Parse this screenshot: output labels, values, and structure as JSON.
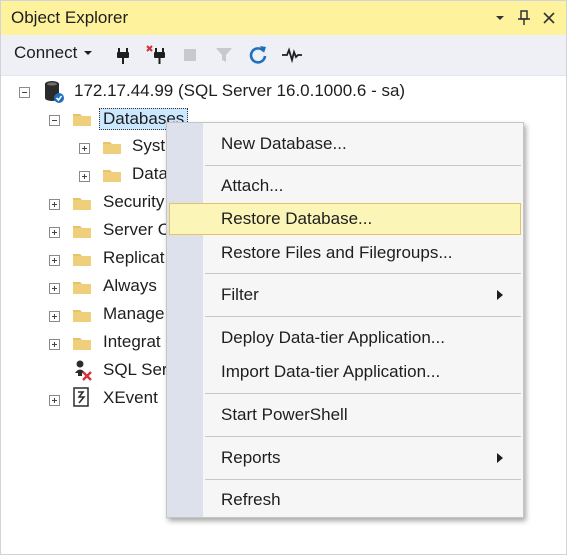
{
  "window": {
    "title": "Object Explorer",
    "controls": {
      "pin_menu": "▾",
      "pin": "📌",
      "close": "✕"
    }
  },
  "toolbar": {
    "connect_label": "Connect",
    "icons": [
      "connect-plug-icon",
      "disconnect-plug-icon",
      "stop-icon",
      "filter-icon",
      "refresh-icon",
      "activity-monitor-icon"
    ]
  },
  "tree": {
    "server_label": "172.17.44.99 (SQL Server 16.0.1000.6 - sa)",
    "databases_label": "Databases",
    "children": {
      "system_dbs": "Syst",
      "data_dbs": "Data"
    },
    "items": [
      {
        "label": "Security"
      },
      {
        "label": "Server O"
      },
      {
        "label": "Replicat"
      },
      {
        "label": "Always"
      },
      {
        "label": "Manage"
      },
      {
        "label": "Integrat"
      },
      {
        "label": "SQL Ser"
      },
      {
        "label": "XEvent"
      }
    ]
  },
  "context_menu": {
    "items": [
      {
        "label": "New Database..."
      },
      {
        "label": "Attach..."
      },
      {
        "label": "Restore Database...",
        "highlighted": true
      },
      {
        "label": "Restore Files and Filegroups..."
      },
      {
        "label": "Filter",
        "submenu": true
      },
      {
        "label": "Deploy Data-tier Application..."
      },
      {
        "label": "Import Data-tier Application..."
      },
      {
        "label": "Start PowerShell"
      },
      {
        "label": "Reports",
        "submenu": true
      },
      {
        "label": "Refresh"
      }
    ]
  },
  "colors": {
    "title_bar": "#fff29d",
    "toolbar": "#eef0f5",
    "highlight": "#fcf5b8",
    "folder": "#e8c36a",
    "selection": "#cce8ff"
  }
}
